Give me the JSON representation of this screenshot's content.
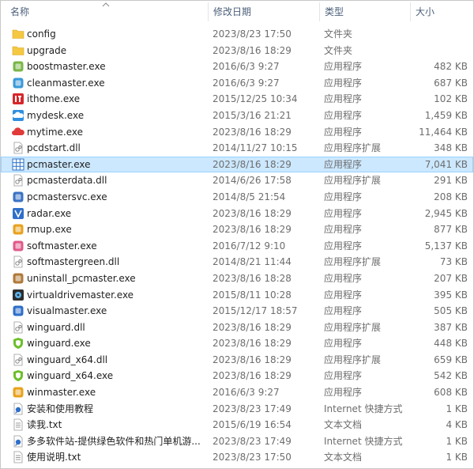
{
  "columns": {
    "name": "名称",
    "date": "修改日期",
    "type": "类型",
    "size": "大小"
  },
  "files": [
    {
      "name": "config",
      "date": "2023/8/23 17:50",
      "type": "文件夹",
      "size": "",
      "icon": "folder-icon",
      "color": "#f5c842"
    },
    {
      "name": "upgrade",
      "date": "2023/8/16 18:29",
      "type": "文件夹",
      "size": "",
      "icon": "folder-icon",
      "color": "#f5c842"
    },
    {
      "name": "boostmaster.exe",
      "date": "2016/6/3 9:27",
      "type": "应用程序",
      "size": "482 KB",
      "icon": "boostmaster-app-icon",
      "color": "#7ab648"
    },
    {
      "name": "cleanmaster.exe",
      "date": "2016/6/3 9:27",
      "type": "应用程序",
      "size": "687 KB",
      "icon": "cleanmaster-app-icon",
      "color": "#3a9ad9"
    },
    {
      "name": "ithome.exe",
      "date": "2015/12/25 10:34",
      "type": "应用程序",
      "size": "102 KB",
      "icon": "ithome-app-icon",
      "color": "#d6262b"
    },
    {
      "name": "mydesk.exe",
      "date": "2015/3/16 21:21",
      "type": "应用程序",
      "size": "1,459 KB",
      "icon": "mydesk-app-icon",
      "color": "#2f8fe0"
    },
    {
      "name": "mytime.exe",
      "date": "2023/8/16 18:29",
      "type": "应用程序",
      "size": "11,464 KB",
      "icon": "mytime-app-icon",
      "color": "#e03a3a"
    },
    {
      "name": "pcdstart.dll",
      "date": "2014/11/27 10:15",
      "type": "应用程序扩展",
      "size": "348 KB",
      "icon": "dll-file-icon",
      "color": "#8a8a8a"
    },
    {
      "name": "pcmaster.exe",
      "date": "2023/8/16 18:29",
      "type": "应用程序",
      "size": "7,041 KB",
      "icon": "pcmaster-grid-icon",
      "color": "#2a6fc9",
      "selected": true
    },
    {
      "name": "pcmasterdata.dll",
      "date": "2014/6/26 17:58",
      "type": "应用程序扩展",
      "size": "291 KB",
      "icon": "dll-file-icon",
      "color": "#8a8a8a"
    },
    {
      "name": "pcmastersvc.exe",
      "date": "2014/8/5 21:54",
      "type": "应用程序",
      "size": "208 KB",
      "icon": "pcmastersvc-app-icon",
      "color": "#3a72c4"
    },
    {
      "name": "radar.exe",
      "date": "2023/8/16 18:29",
      "type": "应用程序",
      "size": "2,945 KB",
      "icon": "radar-app-icon",
      "color": "#2f6fc9"
    },
    {
      "name": "rmup.exe",
      "date": "2023/8/16 18:29",
      "type": "应用程序",
      "size": "877 KB",
      "icon": "rmup-app-icon",
      "color": "#e8a21e"
    },
    {
      "name": "softmaster.exe",
      "date": "2016/7/12 9:10",
      "type": "应用程序",
      "size": "5,137 KB",
      "icon": "softmaster-app-icon",
      "color": "#e05a8a"
    },
    {
      "name": "softmastergreen.dll",
      "date": "2014/8/21 11:44",
      "type": "应用程序扩展",
      "size": "73 KB",
      "icon": "dll-file-icon",
      "color": "#8a8a8a"
    },
    {
      "name": "uninstall_pcmaster.exe",
      "date": "2023/8/16 18:28",
      "type": "应用程序",
      "size": "207 KB",
      "icon": "uninstall-app-icon",
      "color": "#b07a3a"
    },
    {
      "name": "virtualdrivemaster.exe",
      "date": "2015/8/11 10:28",
      "type": "应用程序",
      "size": "395 KB",
      "icon": "virtualdrive-app-icon",
      "color": "#2d2d2d"
    },
    {
      "name": "visualmaster.exe",
      "date": "2015/12/17 18:57",
      "type": "应用程序",
      "size": "505 KB",
      "icon": "visualmaster-app-icon",
      "color": "#2f6fc9"
    },
    {
      "name": "winguard.dll",
      "date": "2023/8/16 18:29",
      "type": "应用程序扩展",
      "size": "387 KB",
      "icon": "dll-file-icon",
      "color": "#8a8a8a"
    },
    {
      "name": "winguard.exe",
      "date": "2023/8/16 18:29",
      "type": "应用程序",
      "size": "448 KB",
      "icon": "winguard-shield-icon",
      "color": "#6cbf2a"
    },
    {
      "name": "winguard_x64.dll",
      "date": "2023/8/16 18:29",
      "type": "应用程序扩展",
      "size": "659 KB",
      "icon": "dll-file-icon",
      "color": "#8a8a8a"
    },
    {
      "name": "winguard_x64.exe",
      "date": "2023/8/16 18:29",
      "type": "应用程序",
      "size": "542 KB",
      "icon": "winguard-shield-icon",
      "color": "#6cbf2a"
    },
    {
      "name": "winmaster.exe",
      "date": "2016/6/3 9:27",
      "type": "应用程序",
      "size": "608 KB",
      "icon": "winmaster-app-icon",
      "color": "#e8a21e"
    },
    {
      "name": "安装和使用教程",
      "date": "2023/8/23 17:49",
      "type": "Internet 快捷方式",
      "size": "1 KB",
      "icon": "internet-shortcut-icon",
      "color": "#2f6fc9"
    },
    {
      "name": "读我.txt",
      "date": "2015/6/19 16:54",
      "type": "文本文档",
      "size": "4 KB",
      "icon": "text-file-icon",
      "color": "#8a8a8a"
    },
    {
      "name": "多多软件站-提供绿色软件和热门单机游...",
      "date": "2023/8/23 17:49",
      "type": "Internet 快捷方式",
      "size": "1 KB",
      "icon": "internet-shortcut-icon",
      "color": "#2f6fc9"
    },
    {
      "name": "使用说明.txt",
      "date": "2023/8/23 17:50",
      "type": "文本文档",
      "size": "1 KB",
      "icon": "text-file-icon",
      "color": "#8a8a8a"
    }
  ]
}
